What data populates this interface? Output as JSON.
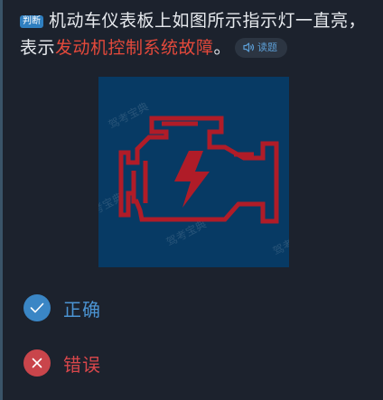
{
  "question": {
    "type_tag": "判断",
    "text_before": "机动车仪表板上如图所示指示灯一直亮，表示",
    "text_highlight": "发动机控制系统故障",
    "text_after": "。",
    "read_button_label": "读题",
    "read_button_icon": "speaker-icon"
  },
  "figure": {
    "watermark": "驾考宝典",
    "icon": "engine-warning-icon",
    "background_color": "#073a64",
    "icon_color": "#b01c28"
  },
  "options": [
    {
      "label": "正确",
      "icon": "check-icon",
      "color": "#3a86c5"
    },
    {
      "label": "错误",
      "icon": "close-icon",
      "color": "#c9454b"
    }
  ]
}
